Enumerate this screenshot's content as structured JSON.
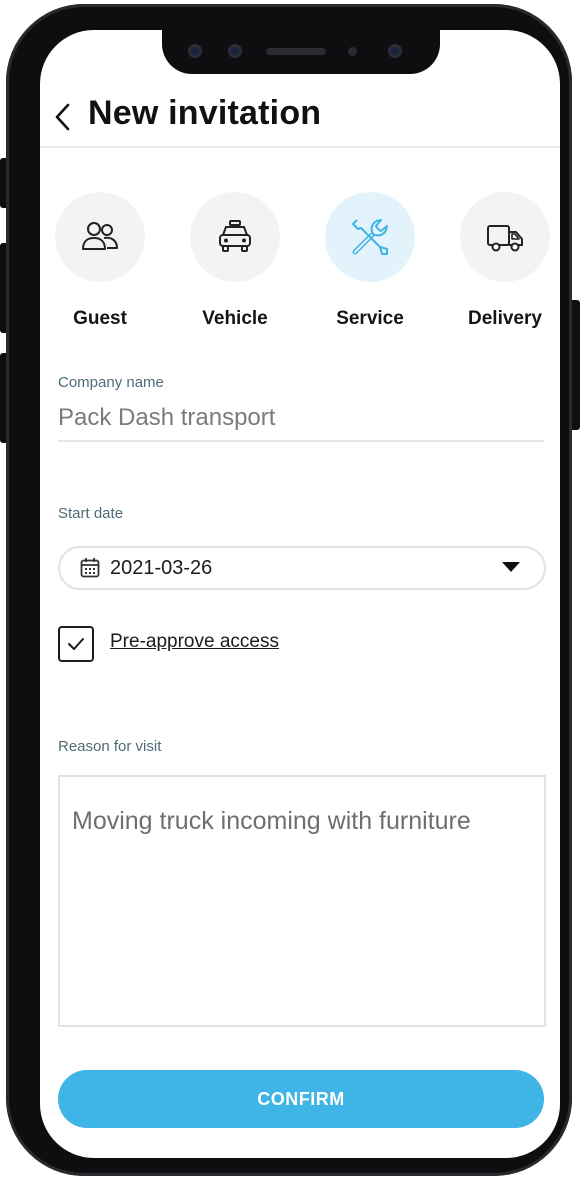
{
  "header": {
    "title": "New invitation"
  },
  "invite_types": [
    {
      "label": "Guest",
      "icon": "guest-icon",
      "active": false
    },
    {
      "label": "Vehicle",
      "icon": "vehicle-icon",
      "active": false
    },
    {
      "label": "Service",
      "icon": "service-tools-icon",
      "active": true
    },
    {
      "label": "Delivery",
      "icon": "delivery-truck-icon",
      "active": false
    }
  ],
  "company": {
    "label": "Company name",
    "value": "Pack Dash transport"
  },
  "start_date": {
    "label": "Start date",
    "value": "2021-03-26"
  },
  "pre_approve": {
    "label": "Pre-approve access",
    "checked": true
  },
  "reason": {
    "label": "Reason for visit",
    "value": "Moving truck incoming with furniture"
  },
  "confirm": {
    "label": "CONFIRM"
  },
  "colors": {
    "accent": "#3fb4e6",
    "active_circle": "#e3f3fb",
    "inactive_circle": "#f2f3f5"
  }
}
